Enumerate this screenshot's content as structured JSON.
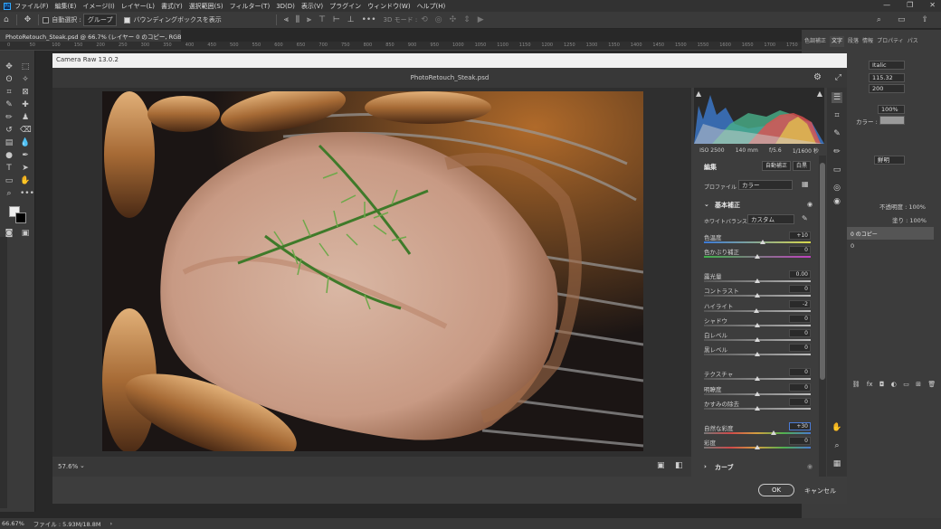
{
  "menubar": {
    "items": [
      "ファイル(F)",
      "編集(E)",
      "イメージ(I)",
      "レイヤー(L)",
      "書式(Y)",
      "選択範囲(S)",
      "フィルター(T)",
      "3D(D)",
      "表示(V)",
      "プラグイン",
      "ウィンドウ(W)",
      "ヘルプ(H)"
    ],
    "app_badge": "Ps"
  },
  "options": {
    "auto_select_label": "自動選択 :",
    "group_label": "グループ",
    "bbox_label": "バウンディングボックスを表示",
    "mode_3d": "3D モード :"
  },
  "document_tab": "PhotoRetouch_Steak.psd @ 66.7% (レイヤー 0 のコピー, RGB/8#) *",
  "ruler_labels": [
    "0",
    "50",
    "100",
    "150",
    "200",
    "250",
    "300",
    "350",
    "400",
    "450",
    "500",
    "550",
    "600",
    "650",
    "700",
    "750",
    "800",
    "850",
    "900",
    "950",
    "1000",
    "1050",
    "1100",
    "1150",
    "1200",
    "1250",
    "1300",
    "1350",
    "1400",
    "1450",
    "1500",
    "1550",
    "1600",
    "1650",
    "1700",
    "1750"
  ],
  "status": {
    "zoom": "66.67%",
    "file": "ファイル : 5.93M/18.8M"
  },
  "right_panel": {
    "tabs": [
      "色調補正",
      "文字",
      "段落",
      "情報",
      "プロパティ",
      "パス"
    ],
    "font_style": "Italic",
    "font_size": "115.32 px",
    "tracking": "200",
    "scale": "100%",
    "color_label": "カラー :",
    "aa": "鮮明",
    "opacity_label": "不透明度 : 100%",
    "fill_label": "塗り : 100%",
    "layer_name": "0 のコピー",
    "layer_name2": "0"
  },
  "camera_raw": {
    "title": "Camera Raw 13.0.2",
    "filename": "PhotoRetouch_Steak.psd",
    "zoom": "57.6%",
    "histogram_info": [
      "ISO 2500",
      "140 mm",
      "f/5.6",
      "1/1600 秒"
    ],
    "edit_label": "編集",
    "auto_button": "自動補正",
    "bw_button": "白黒",
    "profile_label": "プロファイル",
    "profile_value": "カラー",
    "basic_header": "基本補正",
    "wb_label": "ホワイトバランス",
    "wb_value": "カスタム",
    "curve_header": "カーブ",
    "ok_button": "OK",
    "cancel_button": "キャンセル",
    "sliders": [
      {
        "label": "色温度",
        "value": "+10",
        "pos": 0.55,
        "track": "temp"
      },
      {
        "label": "色かぶり補正",
        "value": "0",
        "pos": 0.5,
        "track": "tint"
      },
      {
        "label": "露光量",
        "value": "0.00",
        "pos": 0.5,
        "track": "gray"
      },
      {
        "label": "コントラスト",
        "value": "0",
        "pos": 0.5,
        "track": "gray"
      },
      {
        "label": "ハイライト",
        "value": "-2",
        "pos": 0.49,
        "track": "gray"
      },
      {
        "label": "シャドウ",
        "value": "0",
        "pos": 0.5,
        "track": "gray"
      },
      {
        "label": "白レベル",
        "value": "0",
        "pos": 0.5,
        "track": "gray"
      },
      {
        "label": "黒レベル",
        "value": "0",
        "pos": 0.5,
        "track": "gray"
      },
      {
        "label": "テクスチャ",
        "value": "0",
        "pos": 0.5,
        "track": "gray"
      },
      {
        "label": "明瞭度",
        "value": "0",
        "pos": 0.5,
        "track": "gray"
      },
      {
        "label": "かすみの除去",
        "value": "0",
        "pos": 0.5,
        "track": "gray"
      },
      {
        "label": "自然な彩度",
        "value": "+30",
        "pos": 0.65,
        "track": "vib"
      },
      {
        "label": "彩度",
        "value": "0",
        "pos": 0.5,
        "track": "sat"
      }
    ]
  }
}
